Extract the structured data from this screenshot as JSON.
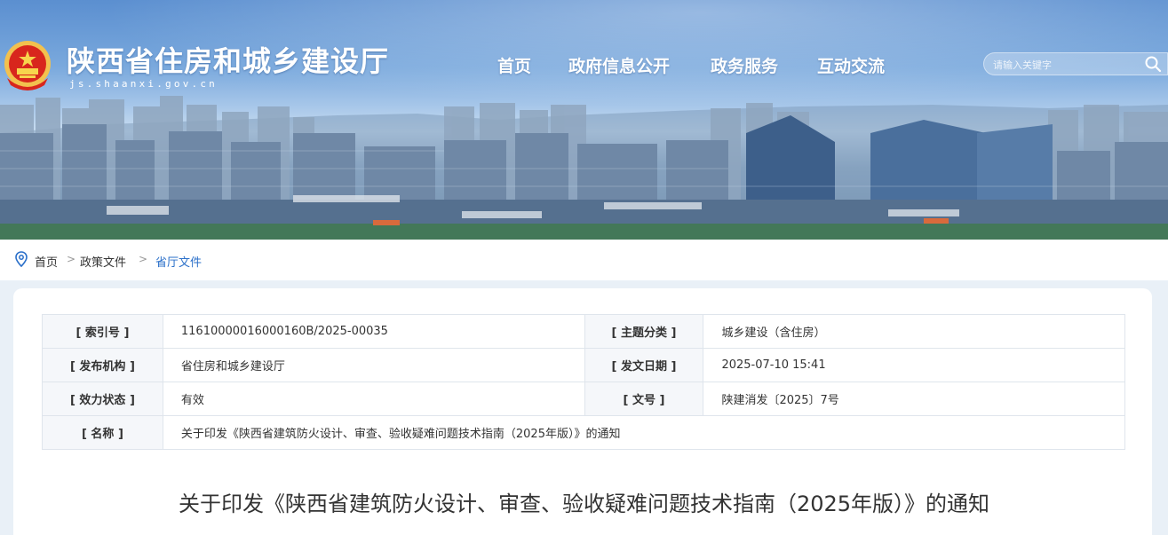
{
  "site": {
    "title": "陕西省住房和城乡建设厅",
    "domain": "js.shaanxi.gov.cn"
  },
  "nav": {
    "items": [
      {
        "label": "首页"
      },
      {
        "label": "政府信息公开"
      },
      {
        "label": "政务服务"
      },
      {
        "label": "互动交流"
      }
    ]
  },
  "search": {
    "placeholder": "请输入关键字"
  },
  "breadcrumb": {
    "items": [
      {
        "label": "首页"
      },
      {
        "label": "政策文件"
      },
      {
        "label": "省厅文件"
      }
    ],
    "separator": ">"
  },
  "meta": {
    "index_label": "[ 索引号 ]",
    "index_value": "11610000016000160B/2025-00035",
    "category_label": "[ 主题分类 ]",
    "category_value": "城乡建设（含住房）",
    "issuer_label": "[ 发布机构 ]",
    "issuer_value": "省住房和城乡建设厅",
    "date_label": "[ 发文日期 ]",
    "date_value": "2025-07-10 15:41",
    "status_label": "[ 效力状态 ]",
    "status_value": "有效",
    "docno_label": "[ 文号 ]",
    "docno_value": "陕建消发〔2025〕7号",
    "name_label": "[ 名称 ]",
    "name_value": "关于印发《陕西省建筑防火设计、审查、验收疑难问题技术指南（2025年版）》的通知"
  },
  "article": {
    "title": "关于印发《陕西省建筑防火设计、审查、验收疑难问题技术指南（2025年版）》的通知"
  },
  "colors": {
    "accent": "#2a6fc9",
    "valid": "#1a9b3c",
    "label_bg": "#f5f7fa"
  },
  "icons": {
    "emblem": "national-emblem-icon",
    "search": "search-icon",
    "location": "location-pin-icon"
  }
}
